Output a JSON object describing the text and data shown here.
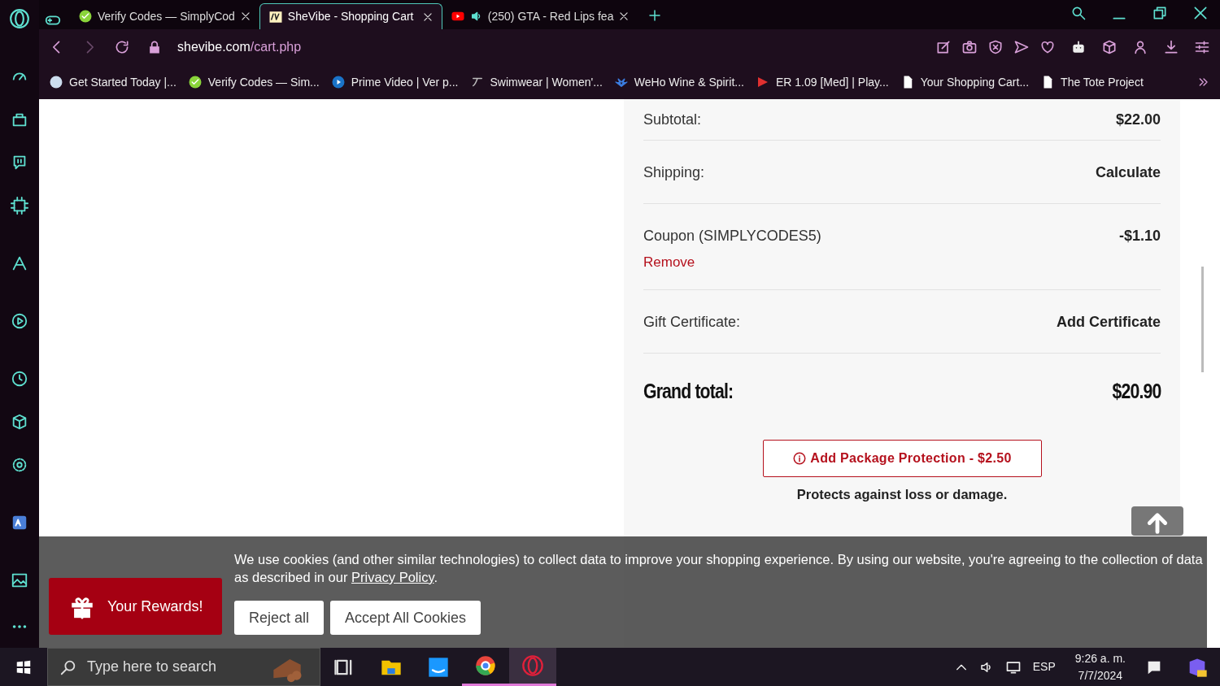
{
  "tabs": [
    {
      "title": "Verify Codes — SimplyCod",
      "kind": "check",
      "selected": false,
      "audio": false
    },
    {
      "title": "SheVibe - Shopping Cart",
      "kind": "logo",
      "selected": true,
      "audio": false
    },
    {
      "title": "(250) GTA - Red Lips fea",
      "kind": "video",
      "selected": false,
      "audio": true
    }
  ],
  "address": {
    "host": "shevibe.com",
    "path": "/cart.php"
  },
  "bookmarks": [
    {
      "title": "Get Started Today |...",
      "kind": "round"
    },
    {
      "title": "Verify Codes — Sim...",
      "kind": "check"
    },
    {
      "title": "Prime Video | Ver p...",
      "kind": "play"
    },
    {
      "title": "Swimwear | Women'...",
      "kind": "script"
    },
    {
      "title": "WeHo Wine & Spirit...",
      "kind": "lotus"
    },
    {
      "title": "ER 1.09 [Med] | Play...",
      "kind": "stripes"
    },
    {
      "title": "Your Shopping Cart...",
      "kind": "page"
    },
    {
      "title": "The Tote Project",
      "kind": "page"
    }
  ],
  "summary": [
    {
      "label": "Subtotal:",
      "value": "$22.00"
    },
    {
      "label": "Shipping:",
      "value": "Calculate"
    },
    {
      "label": "Coupon (SIMPLYCODES5)",
      "value": "-$1.10",
      "link": "Remove"
    },
    {
      "label": "Gift Certificate:",
      "value": "Add Certificate"
    }
  ],
  "grand_total": {
    "label": "Grand total:",
    "value": "$20.90"
  },
  "protection_button": "Add Package Protection - $2.50",
  "protection_note": "Protects against loss or damage.",
  "cookie_banner": {
    "text_before": "We use cookies (and other similar technologies) to collect data to improve your shopping experience. By using our website, you're agreeing to the collection of data as described in our ",
    "link": "Privacy Policy",
    "text_after": ".",
    "buttons": [
      "Reject all",
      "Accept All Cookies"
    ]
  },
  "rewards_button": "Your Rewards!",
  "taskbar": {
    "search_placeholder": "Type here to search",
    "language": "ESP",
    "time": "9:26 a. m.",
    "date": "7/7/2024"
  }
}
